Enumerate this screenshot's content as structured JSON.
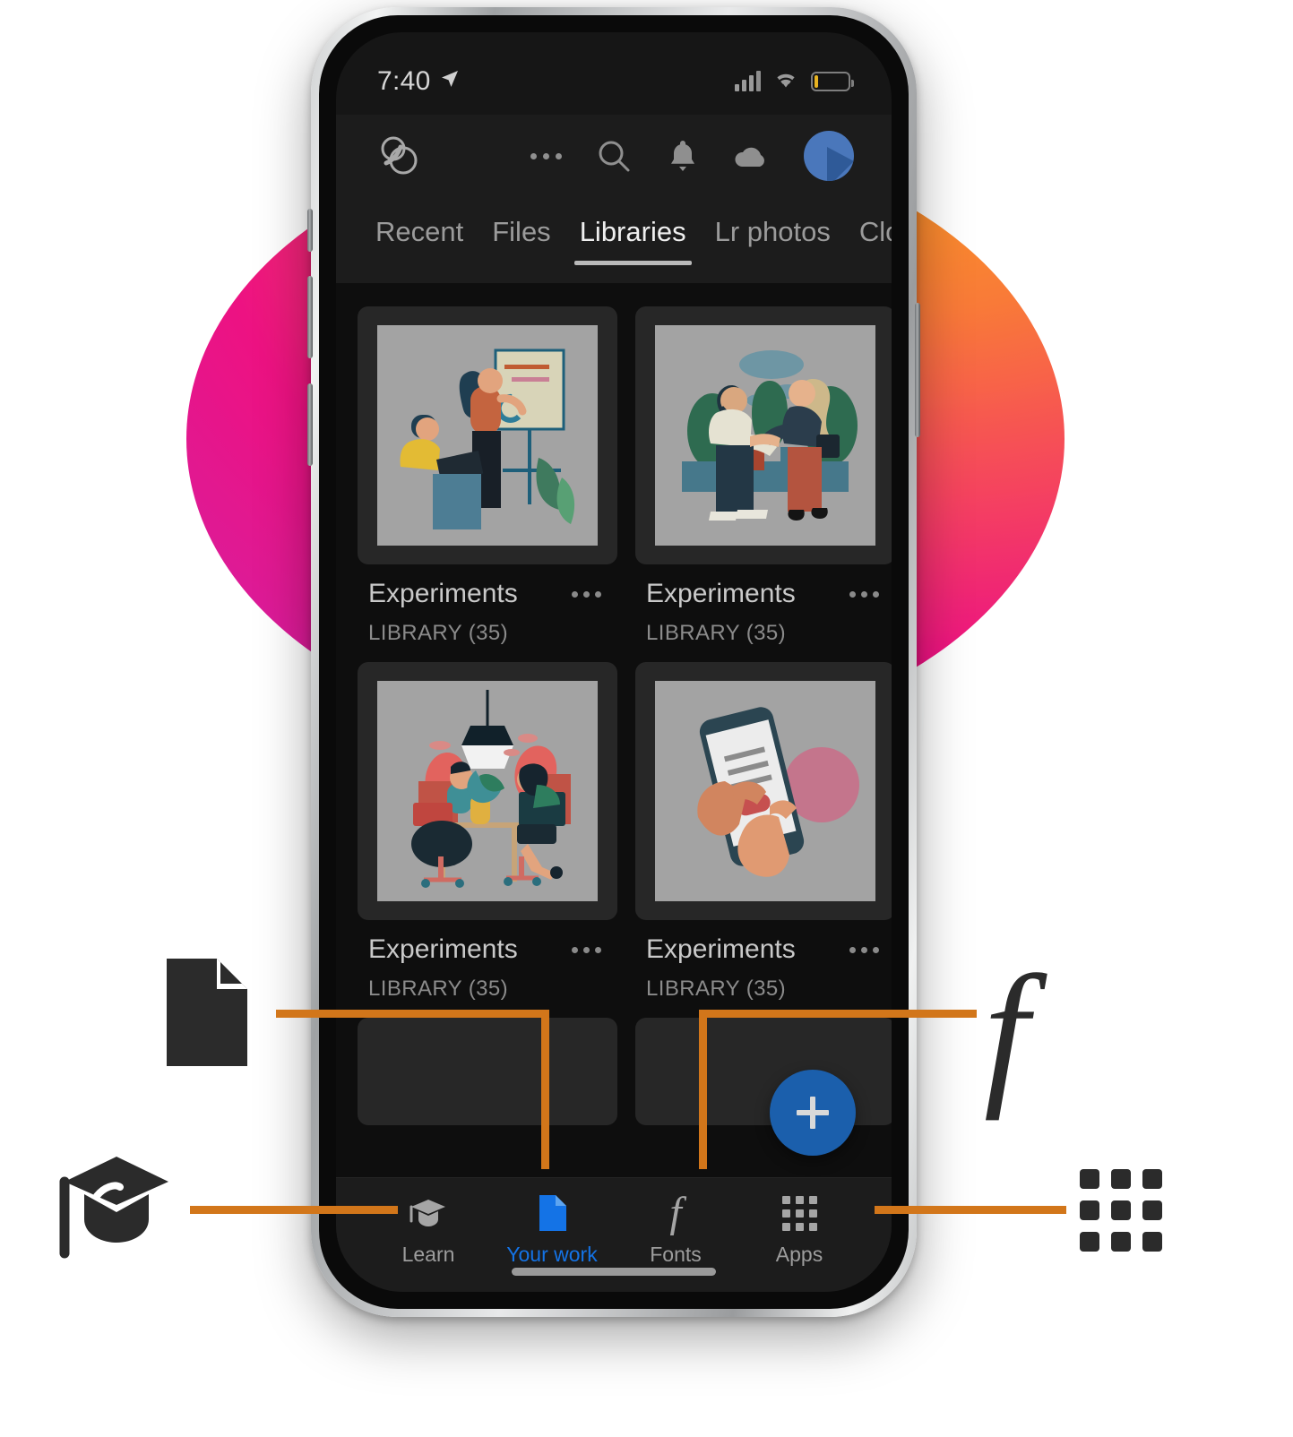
{
  "statusbar": {
    "time": "7:40",
    "location_icon": "location-arrow-icon",
    "signal_icon": "cellular-signal-icon",
    "wifi_icon": "wifi-icon",
    "battery_icon": "battery-low-icon",
    "battery_color": "#e8b321"
  },
  "header": {
    "logo": "creative-cloud-logo",
    "overflow_label": "•••",
    "icons": [
      "overflow-menu-icon",
      "search-icon",
      "notifications-bell-icon",
      "cloud-icon",
      "avatar"
    ]
  },
  "tabs": [
    {
      "label": "Recent",
      "active": false
    },
    {
      "label": "Files",
      "active": false
    },
    {
      "label": "Libraries",
      "active": true
    },
    {
      "label": "Lr photos",
      "active": false
    },
    {
      "label": "Cloud docs",
      "active": false
    }
  ],
  "library_cards": [
    {
      "title": "Experiments",
      "subtitle": "LIBRARY (35)",
      "thumbnail": "illustration-presentation-whiteboard"
    },
    {
      "title": "Experiments",
      "subtitle": "LIBRARY (35)",
      "thumbnail": "illustration-handshake-outdoors"
    },
    {
      "title": "Experiments",
      "subtitle": "LIBRARY (35)",
      "thumbnail": "illustration-coworking-desks"
    },
    {
      "title": "Experiments",
      "subtitle": "LIBRARY (35)",
      "thumbnail": "illustration-hands-holding-phone"
    }
  ],
  "fab": {
    "icon": "plus-icon",
    "color": "#1b5fac"
  },
  "bottom_nav": [
    {
      "label": "Learn",
      "icon": "graduation-cap-icon",
      "active": false
    },
    {
      "label": "Your work",
      "icon": "document-icon",
      "active": true
    },
    {
      "label": "Fonts",
      "icon": "font-f-icon",
      "active": false
    },
    {
      "label": "Apps",
      "icon": "apps-grid-icon",
      "active": false
    }
  ],
  "annotations": {
    "connector_color": "#d2761a",
    "items": [
      {
        "icon": "document-icon",
        "targets": "Your work"
      },
      {
        "icon": "graduation-cap-icon",
        "targets": "Learn"
      },
      {
        "icon": "font-f-icon",
        "targets": "Fonts",
        "glyph": "f"
      },
      {
        "icon": "apps-grid-icon",
        "targets": "Apps"
      }
    ]
  },
  "colors": {
    "accent_blue": "#1473e6",
    "fab_blue": "#1b5fac",
    "annotation_orange": "#d2761a",
    "screen_bg": "#0e0e0e",
    "chrome_bg": "#1c1c1c"
  }
}
